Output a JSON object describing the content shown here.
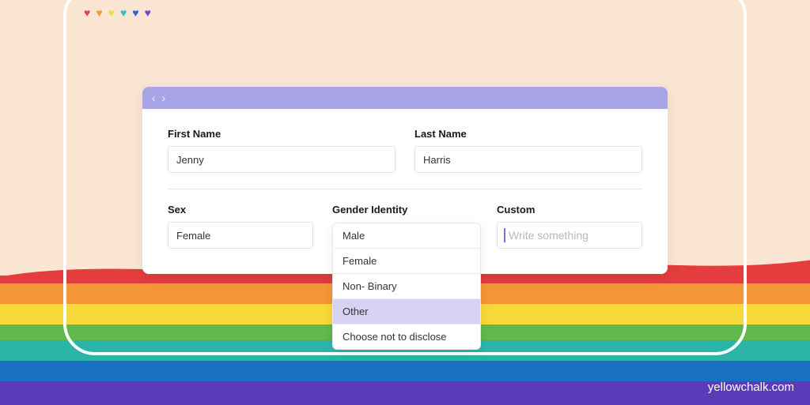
{
  "hearts": {
    "colors": [
      "#e84343",
      "#f59638",
      "#f5d938",
      "#2ec4b6",
      "#2962d9",
      "#7b3fc4"
    ]
  },
  "form": {
    "firstName": {
      "label": "First Name",
      "value": "Jenny"
    },
    "lastName": {
      "label": "Last Name",
      "value": "Harris"
    },
    "sex": {
      "label": "Sex",
      "value": "Female"
    },
    "genderIdentity": {
      "label": "Gender Identity",
      "options": [
        "Male",
        "Female",
        "Non- Binary",
        "Other",
        "Choose not to disclose"
      ],
      "selected": "Other"
    },
    "custom": {
      "label": "Custom",
      "placeholder": "Write something"
    }
  },
  "credit": "yellowchalk.com",
  "rainbow": {
    "stripes": [
      "#e33d3d",
      "#f59638",
      "#f5d938",
      "#62b84a",
      "#2bb5a8",
      "#1b6fc2",
      "#5c3bb8"
    ]
  }
}
